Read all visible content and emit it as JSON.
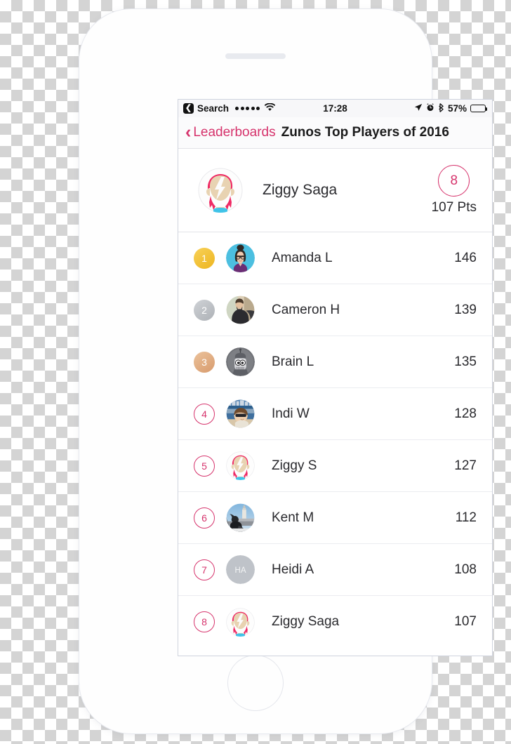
{
  "status_bar": {
    "back_label": "Search",
    "back_icon": "chevron-left-icon",
    "signal_dots": 5,
    "wifi_icon": "wifi-icon",
    "time": "17:28",
    "location_icon": "location-arrow-icon",
    "alarm_icon": "alarm-clock-icon",
    "bluetooth_icon": "bluetooth-icon",
    "battery_percent": "57%",
    "battery_level": 57
  },
  "nav_bar": {
    "back_icon": "chevron-left-icon",
    "back_label": "Leaderboards",
    "title": "Zunos Top Players of 2016"
  },
  "profile": {
    "avatar": "ziggy-avatar",
    "name": "Ziggy Saga",
    "rank": "8",
    "points": "107 Pts"
  },
  "leaderboard": [
    {
      "rank": "1",
      "badge_style": "gold",
      "avatar": "amanda-avatar",
      "name": "Amanda L",
      "score": "146"
    },
    {
      "rank": "2",
      "badge_style": "silver",
      "avatar": "cameron-avatar",
      "name": "Cameron H",
      "score": "139"
    },
    {
      "rank": "3",
      "badge_style": "bronze",
      "avatar": "robot-avatar",
      "name": "Brain L",
      "score": "135"
    },
    {
      "rank": "4",
      "badge_style": "plain",
      "avatar": "indi-avatar",
      "name": "Indi W",
      "score": "128"
    },
    {
      "rank": "5",
      "badge_style": "plain",
      "avatar": "ziggy-avatar",
      "name": "Ziggy S",
      "score": "127"
    },
    {
      "rank": "6",
      "badge_style": "plain",
      "avatar": "kent-avatar",
      "name": "Kent M",
      "score": "112"
    },
    {
      "rank": "7",
      "badge_style": "plain",
      "avatar": "initials-avatar",
      "name": "Heidi A",
      "score": "108",
      "initials": "HA"
    },
    {
      "rank": "8",
      "badge_style": "plain",
      "avatar": "ziggy-avatar",
      "name": "Ziggy Saga",
      "score": "107"
    }
  ],
  "colors": {
    "accent_pink": "#d6336c",
    "gold": "#edb51f",
    "silver": "#adb1b6",
    "bronze": "#d89b6d",
    "text": "#2a2a2e"
  },
  "device": {
    "speaker_grille": "speaker-grille",
    "home_button": "home-button"
  }
}
